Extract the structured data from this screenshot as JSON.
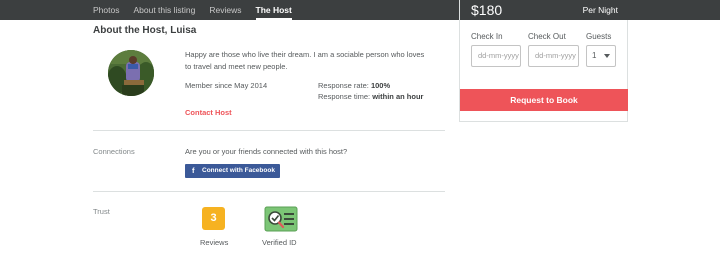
{
  "nav": {
    "tabs": [
      {
        "label": "Photos"
      },
      {
        "label": "About this listing"
      },
      {
        "label": "Reviews"
      },
      {
        "label": "The Host"
      }
    ]
  },
  "booking": {
    "price": "$180",
    "per": "Per Night",
    "check_in_label": "Check In",
    "check_out_label": "Check Out",
    "guests_label": "Guests",
    "check_in_placeholder": "dd-mm-yyyy",
    "check_out_placeholder": "dd-mm-yyyy",
    "guests_value": "1",
    "request_label": "Request to Book",
    "accent": "#ee5459"
  },
  "host": {
    "title": "About the Host, Luisa",
    "bio": "Happy are those who live their dream. I am a sociable person who loves to travel and meet new people.",
    "member_since": "Member since May 2014",
    "response_rate_label": "Response rate:",
    "response_rate_value": "100%",
    "response_time_label": "Response time:",
    "response_time_value": "within an hour",
    "contact_label": "Contact Host"
  },
  "connections": {
    "label": "Connections",
    "question": "Are you or your friends connected with this host?",
    "facebook_icon": "f",
    "facebook_button": "Connect with Facebook"
  },
  "trust": {
    "label": "Trust",
    "reviews_count": "3",
    "reviews_label": "Reviews",
    "verified_label": "Verified ID"
  }
}
